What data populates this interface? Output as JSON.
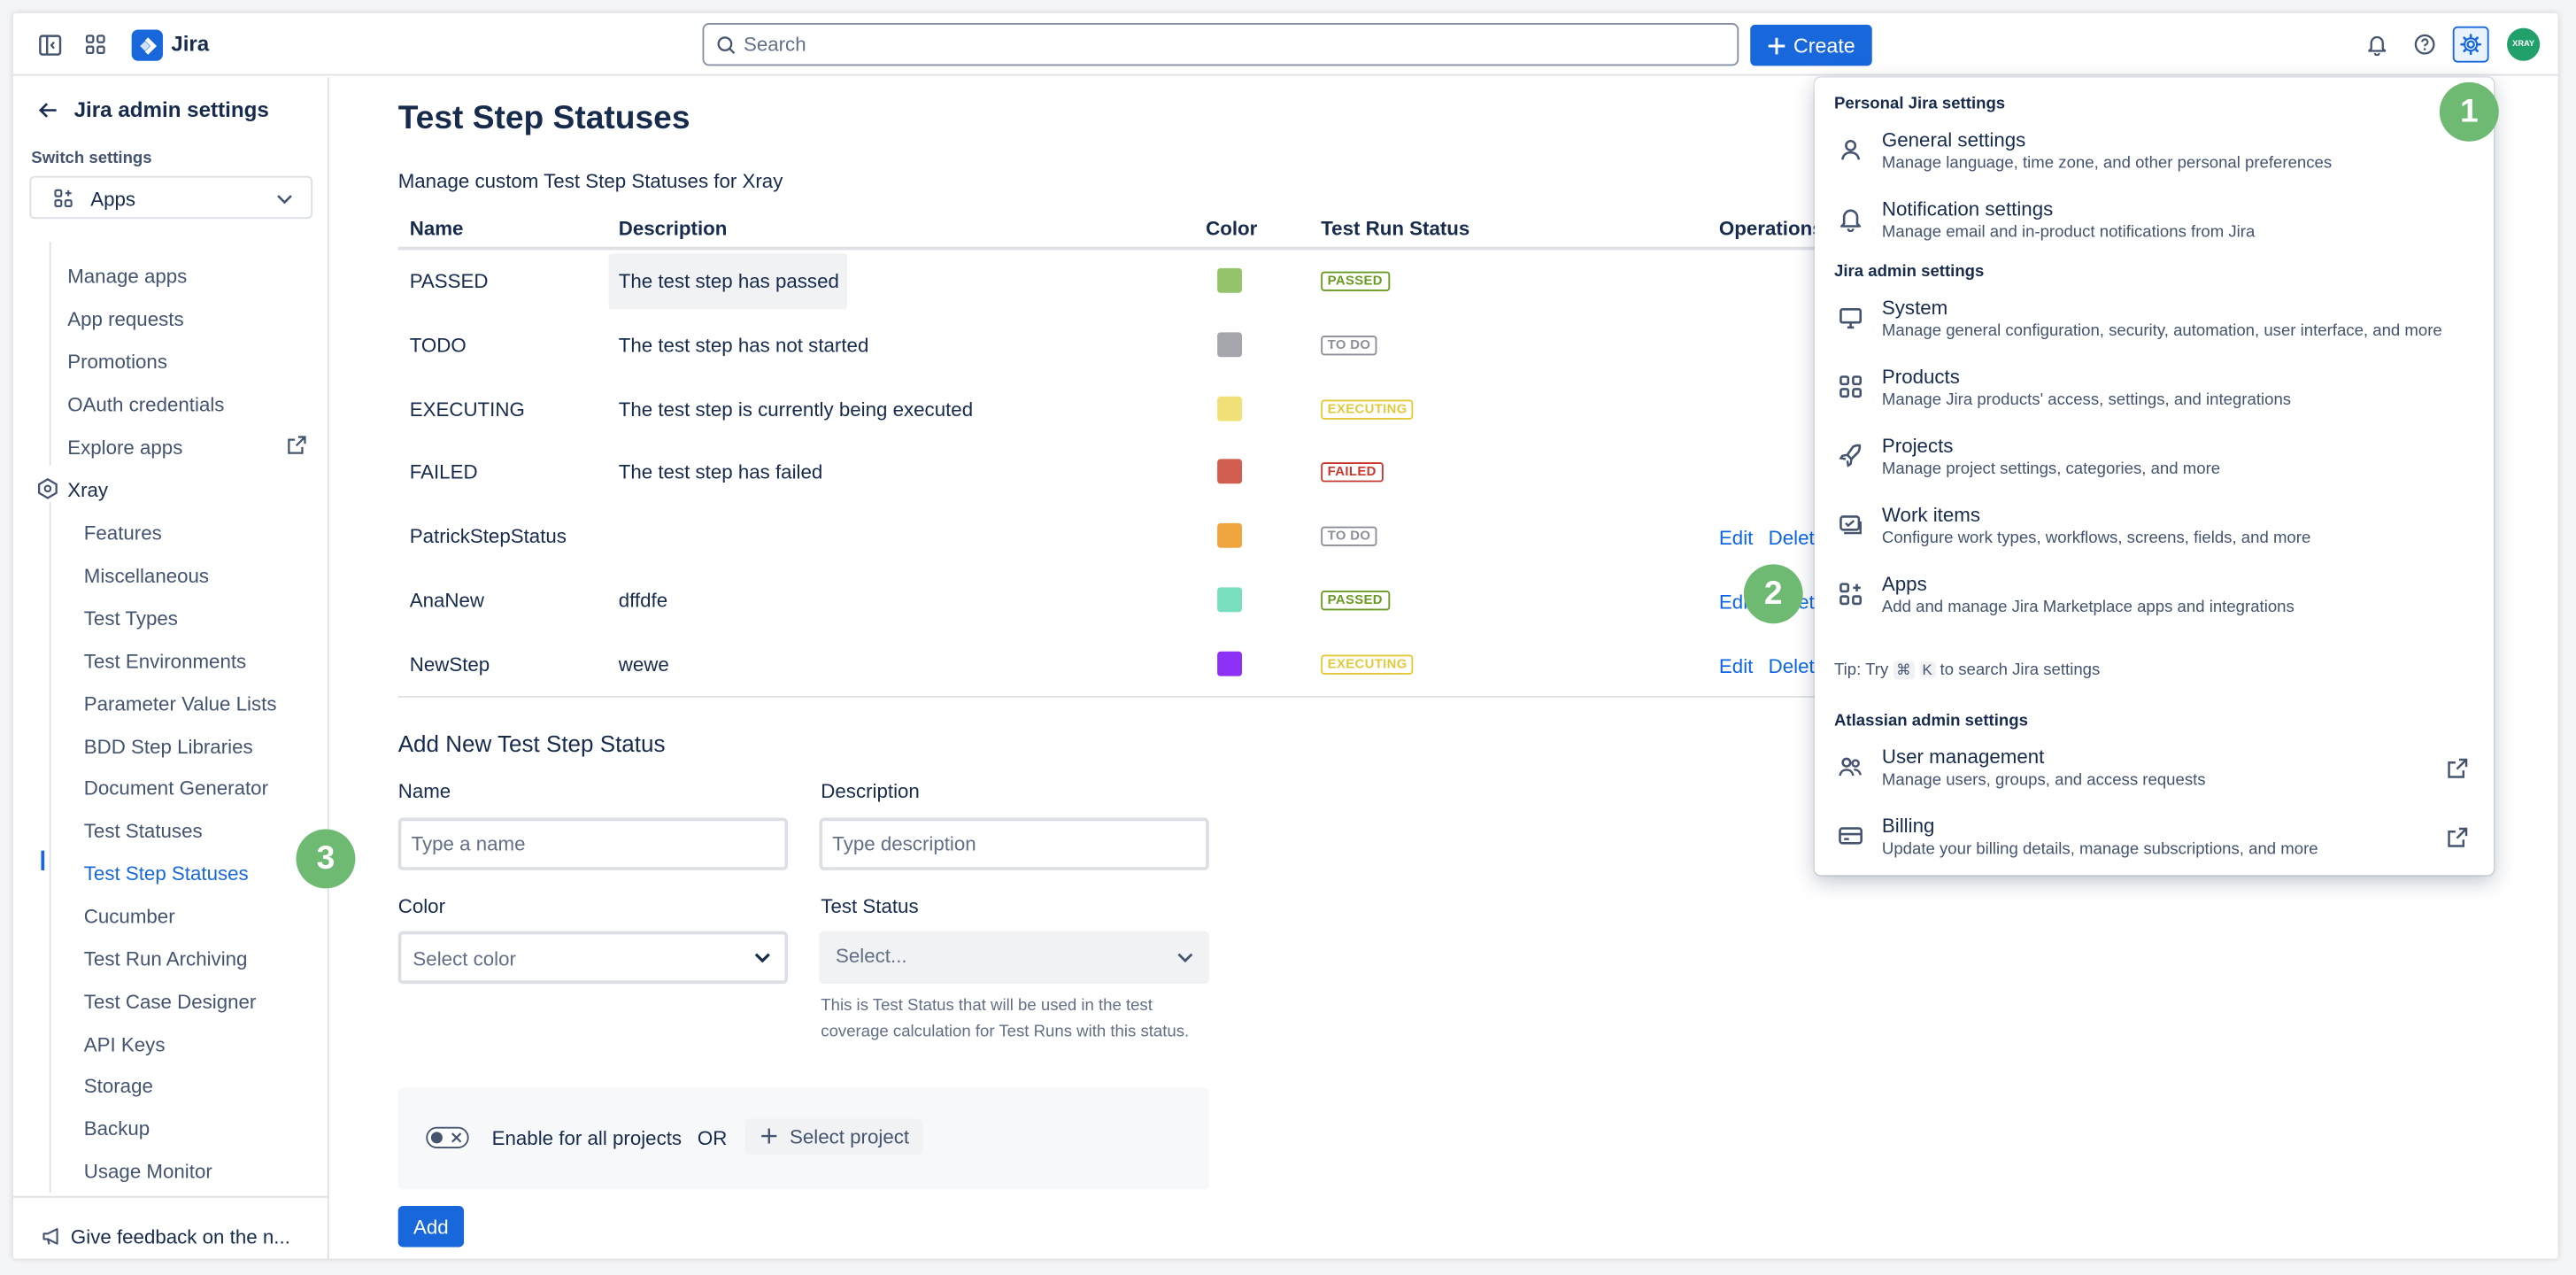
{
  "topbar": {
    "app_name": "Jira",
    "search_placeholder": "Search",
    "create_label": "Create",
    "avatar_text": "XRAY"
  },
  "sidebar": {
    "title": "Jira admin settings",
    "switch_label": "Switch settings",
    "switch_value": "Apps",
    "apps_items": [
      "Manage apps",
      "App requests",
      "Promotions",
      "OAuth credentials",
      "Explore apps"
    ],
    "xray_label": "Xray",
    "xray_items": [
      "Features",
      "Miscellaneous",
      "Test Types",
      "Test Environments",
      "Parameter Value Lists",
      "BDD Step Libraries",
      "Document Generator",
      "Test Statuses",
      "Test Step Statuses",
      "Cucumber",
      "Test Run Archiving",
      "Test Case Designer",
      "API Keys",
      "Storage",
      "Backup",
      "Usage Monitor"
    ],
    "active_item": "Test Step Statuses",
    "feedback": "Give feedback on the n..."
  },
  "main": {
    "title": "Test Step Statuses",
    "subtitle": "Manage custom Test Step Statuses for Xray",
    "columns": [
      "Name",
      "Description",
      "Color",
      "Test Run Status",
      "Operations"
    ],
    "rows": [
      {
        "name": "PASSED",
        "description": "The test step has passed",
        "color": "#94c36b",
        "status": "PASSED",
        "ops": [
          "",
          ""
        ]
      },
      {
        "name": "TODO",
        "description": "The test step has not started",
        "color": "#a5a6ab",
        "status": "TO DO",
        "ops": [
          "",
          ""
        ]
      },
      {
        "name": "EXECUTING",
        "description": "The test step is currently being executed",
        "color": "#f1e078",
        "status": "EXECUTING",
        "ops": [
          "",
          ""
        ]
      },
      {
        "name": "FAILED",
        "description": "The test step has failed",
        "color": "#d15e4e",
        "status": "FAILED",
        "ops": [
          "",
          ""
        ]
      },
      {
        "name": "PatrickStepStatus",
        "description": "",
        "color": "#f0a53f",
        "status": "TO DO",
        "ops": [
          "Edit",
          "Delete"
        ]
      },
      {
        "name": "AnaNew",
        "description": "dffdfe",
        "color": "#78dec0",
        "status": "PASSED",
        "ops": [
          "Edit",
          "Delete"
        ]
      },
      {
        "name": "NewStep",
        "description": "wewe",
        "color": "#8c31f5",
        "status": "EXECUTING",
        "ops": [
          "Edit",
          "Delete"
        ]
      }
    ],
    "status_colors": {
      "PASSED": "#6a9a23",
      "TO DO": "#8c8f97",
      "EXECUTING": "#e2c93b",
      "FAILED": "#c9372c"
    },
    "form": {
      "title": "Add New Test Step Status",
      "name_label": "Name",
      "name_placeholder": "Type a name",
      "desc_label": "Description",
      "desc_placeholder": "Type description",
      "color_label": "Color",
      "color_value": "Select color",
      "status_label": "Test Status",
      "status_value": "Select...",
      "status_help": "This is Test Status that will be used in the test coverage calculation for Test Runs with this status.",
      "enable_label": "Enable for all projects",
      "or_label": "OR",
      "select_project": "Select project",
      "add_label": "Add"
    }
  },
  "dropdown": {
    "personal_head": "Personal Jira settings",
    "general_title": "General settings",
    "general_desc": "Manage language, time zone, and other personal preferences",
    "notif_title": "Notification settings",
    "notif_desc": "Manage email and in-product notifications from Jira",
    "admin_head": "Jira admin settings",
    "system_title": "System",
    "system_desc": "Manage general configuration, security, automation, user interface, and more",
    "products_title": "Products",
    "products_desc": "Manage Jira products' access, settings, and integrations",
    "projects_title": "Projects",
    "projects_desc": "Manage project settings, categories, and more",
    "work_title": "Work items",
    "work_desc": "Configure work types, workflows, screens, fields, and more",
    "apps_title": "Apps",
    "apps_desc": "Add and manage Jira Marketplace apps and integrations",
    "tip_prefix": "Tip: Try",
    "tip_key1": "⌘",
    "tip_key2": "K",
    "tip_suffix": "to search Jira settings",
    "atlassian_head": "Atlassian admin settings",
    "users_title": "User management",
    "users_desc": "Manage users, groups, and access requests",
    "billing_title": "Billing",
    "billing_desc": "Update your billing details, manage subscriptions, and more"
  },
  "badges": [
    "1",
    "2",
    "3"
  ]
}
